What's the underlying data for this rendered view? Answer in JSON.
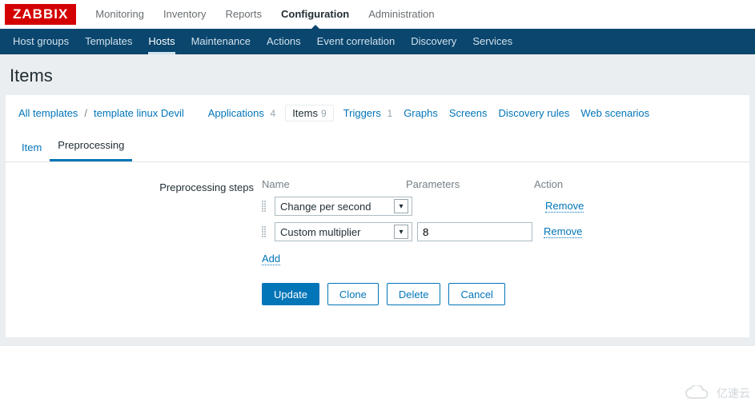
{
  "logo": "ZABBIX",
  "topnav": {
    "items": [
      "Monitoring",
      "Inventory",
      "Reports",
      "Configuration",
      "Administration"
    ],
    "active": "Configuration"
  },
  "subnav": {
    "items": [
      "Host groups",
      "Templates",
      "Hosts",
      "Maintenance",
      "Actions",
      "Event correlation",
      "Discovery",
      "Services"
    ],
    "active": "Hosts"
  },
  "page_title": "Items",
  "breadcrumb": {
    "all_templates": "All templates",
    "template_name": "template linux Devil",
    "applications_label": "Applications",
    "applications_count": "4",
    "items_label": "Items",
    "items_count": "9",
    "triggers_label": "Triggers",
    "triggers_count": "1",
    "graphs_label": "Graphs",
    "screens_label": "Screens",
    "discovery_label": "Discovery rules",
    "web_label": "Web scenarios"
  },
  "tabs": {
    "item": "Item",
    "preprocessing": "Preprocessing"
  },
  "form": {
    "steps_label": "Preprocessing steps",
    "col_name": "Name",
    "col_params": "Parameters",
    "col_action": "Action",
    "row1_name": "Change per second",
    "row1_remove": "Remove",
    "row2_name": "Custom multiplier",
    "row2_param": "8",
    "row2_remove": "Remove",
    "add": "Add",
    "btn_update": "Update",
    "btn_clone": "Clone",
    "btn_delete": "Delete",
    "btn_cancel": "Cancel"
  },
  "watermark": "亿速云"
}
